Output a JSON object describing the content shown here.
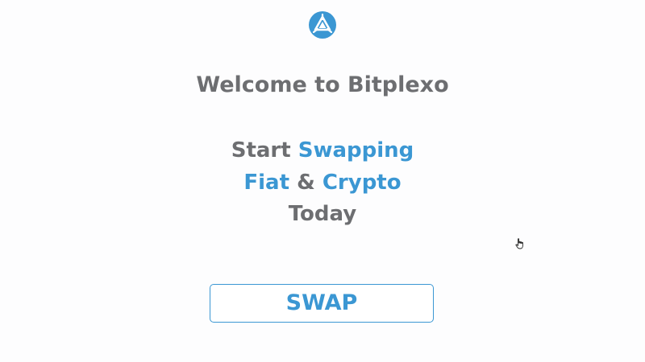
{
  "brand": {
    "logo_icon": "bitplexo-logo-icon",
    "accent_color": "#3b97d3",
    "text_color": "#6d6e71"
  },
  "welcome": {
    "title": "Welcome to Bitplexo"
  },
  "tagline": {
    "line1_start": "Start",
    "line1_accent": "Swapping",
    "line2_accent1": "Fiat",
    "line2_amp": "&",
    "line2_accent2": "Crypto",
    "line3": "Today"
  },
  "actions": {
    "swap_label": "SWAP"
  },
  "pointer": {
    "icon": "hand-pointer-icon"
  }
}
